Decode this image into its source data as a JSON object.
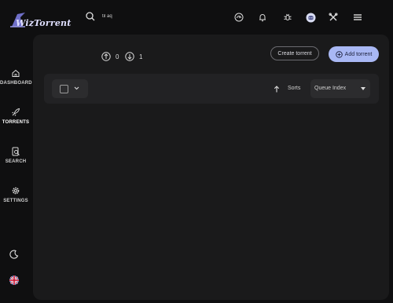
{
  "app": {
    "logo_text": "WizTorrent"
  },
  "header": {
    "search": {
      "value": "til aq",
      "placeholder": ""
    },
    "icons": [
      "speedometer-icon",
      "bell-icon",
      "bug-icon",
      "discord-icon",
      "tools-icon",
      "menu-icon"
    ]
  },
  "sidebar": {
    "items": [
      {
        "label": "DASHBOARD",
        "icon": "home-icon"
      },
      {
        "label": "TORRENTS",
        "icon": "rocket-icon"
      },
      {
        "label": "SEARCH",
        "icon": "search-doc-icon"
      },
      {
        "label": "SETTINGS",
        "icon": "gear-icon"
      }
    ],
    "bottom_icons": [
      "moon-icon",
      "uk-flag-icon"
    ]
  },
  "stats": {
    "upload_count": "0",
    "download_count": "1"
  },
  "actions": {
    "create_label": "Create torrent",
    "add_label": "Add torrent"
  },
  "toolbar": {
    "sorts_label": "Sorts",
    "sort_value": "Queue Index"
  },
  "colors": {
    "accent": "#a9b8f4",
    "background": "#0f0f10",
    "panel": "#1a1a1b"
  }
}
